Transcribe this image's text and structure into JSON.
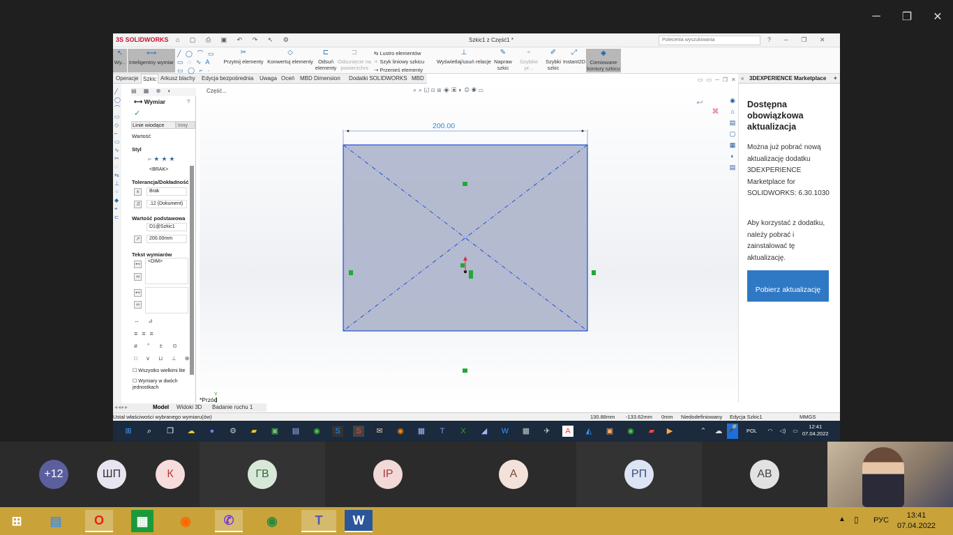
{
  "meeting": {
    "window_controls": {
      "minimize": "─",
      "maximize": "❐",
      "close": "✕"
    },
    "participants": [
      {
        "initials": "+12",
        "color": "#5b5f9e",
        "text_color": "#ffffff"
      },
      {
        "initials": "ШП",
        "color": "#e8e4f0",
        "text_color": "#333333"
      },
      {
        "initials": "К",
        "color": "#f6dcdc",
        "text_color": "#b33a3a"
      },
      {
        "initials": "ГВ",
        "color": "#d8e8d8",
        "text_color": "#2f6a3a"
      },
      {
        "initials": "ІР",
        "color": "#f3d8d8",
        "text_color": "#a33a3a"
      },
      {
        "initials": "А",
        "color": "#f3e2da",
        "text_color": "#7a4a3a"
      },
      {
        "initials": "РП",
        "color": "#dde4f3",
        "text_color": "#3a4a7a"
      },
      {
        "initials": "АВ",
        "color": "#e2e2e2",
        "text_color": "#444444"
      }
    ]
  },
  "sw": {
    "logo": "3S SOLIDWORKS",
    "document_title": "Szkic1 z Część1 *",
    "search_placeholder": "Polecenia wyszukiwania",
    "ribbon": [
      {
        "label": "Wy...",
        "icon": "↖"
      },
      {
        "label": "Inteligentny wymiar",
        "icon": "⟷"
      },
      {
        "label": "Przytnij elementy",
        "icon": "✂"
      },
      {
        "label": "Konwertuj elementy",
        "icon": "◇"
      },
      {
        "label": "Odsuń elementy",
        "icon": "⊏"
      },
      {
        "label": "Odsunięcie na powierzchni",
        "icon": "⊐"
      },
      {
        "label": "Lustro elementów",
        "icon": "⇆"
      },
      {
        "label": "Szyk liniowy szkicu",
        "icon": "⁘"
      },
      {
        "label": "Przenieś elementy",
        "icon": "⇢"
      },
      {
        "label": "Wyświetlaj/usuń relacje",
        "icon": "⊥"
      },
      {
        "label": "Napraw szkic",
        "icon": "✎"
      },
      {
        "label": "Szybkie pr...",
        "icon": "⌖"
      },
      {
        "label": "Szybki szkic",
        "icon": "✐"
      },
      {
        "label": "Instant2D",
        "icon": "⤢"
      },
      {
        "label": "Cieniowane kontury szkicu",
        "icon": "◆"
      }
    ],
    "tabs": [
      "Operacje",
      "Szkic",
      "Arkusz blachy",
      "Edycja bezpośrednia",
      "Uwaga",
      "Oceń",
      "MBD Dimension",
      "Dodatki SOLIDWORKS",
      "MBD"
    ],
    "active_tab": "Szkic",
    "property_manager": {
      "title": "Wymiar",
      "subtabs": [
        "Linie wiodące",
        "Inny"
      ],
      "section_value": "Wartość",
      "section_style": "Styl",
      "style_value": "<BRAK>",
      "section_tolerance": "Tolerancja/Dokładność",
      "tolerance_type": "Brak",
      "precision": ".12 (Dokument)",
      "section_primary": "Wartość podstawowa",
      "primary_name": "D1@Szkic1",
      "primary_value": "200.00mm",
      "section_text": "Tekst wymiarów",
      "dim_text": "<DIM>",
      "checkbox_uppercase": "Wszystko wielkimi lite",
      "checkbox_dual": "Wymiary w dwóch jednostkach"
    },
    "breadcrumb": "Część...",
    "dimension_label": "200.00",
    "view_name": "*Przód",
    "bottom_tabs": [
      "Model",
      "Widoki 3D",
      "Badanie ruchu 1"
    ],
    "status": {
      "message": "Ustal właściwości wybranego wymiaru(ów)",
      "x": "130.88mm",
      "y": "-133.62mm",
      "z": "0mm",
      "state": "Niedodefiniowany",
      "edit": "Edycja Szkic1",
      "units": "MMGS"
    },
    "taskpane": {
      "header": "3DEXPERIENCE Marketplace",
      "title": "Dostępna obowiązkowa aktualizacja",
      "p1": "Można już pobrać nową aktualizację dodatku 3DEXPERIENCE Marketplace for SOLIDWORKS: 6.30.1030",
      "p2": "Aby korzystać z dodatku, należy pobrać i zainstalować tę aktualizację.",
      "button": "Pobierz aktualizację"
    }
  },
  "inner_taskbar": {
    "lang": "POL",
    "time": "12:41",
    "date": "07.04.2022"
  },
  "taskbar": {
    "lang": "РУС",
    "time": "13:41",
    "date": "07.04.2022"
  },
  "colors": {
    "sketch_blue": "#1f4fd6",
    "sketch_fill": "#a9b0c8",
    "relation_green": "#22a83a",
    "taskbar": "#c9a33a",
    "button_blue": "#2f78c4"
  }
}
